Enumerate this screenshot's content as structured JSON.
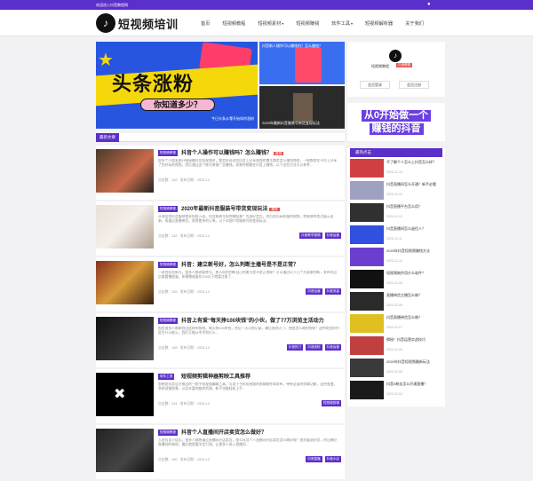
{
  "topbar": {
    "welcome": "欢迎进入抖音教程网"
  },
  "logo": {
    "text": "短视频培训"
  },
  "nav": [
    "首页",
    "短视频教程",
    "短视频素材",
    "短视频赚钱",
    "软件工具",
    "短视频解析器",
    "关于我们"
  ],
  "hero": {
    "main_title": "头条涨粉",
    "main_pill": "你知道多少？",
    "main_caption": "今日头条从零开始如何涨粉",
    "r1_caption": "抖音新人操作可以赚钱吗？怎么赚钱？",
    "r2_caption": "2020年最新抖音服装号带货变现玩法"
  },
  "section": {
    "title": "最新文章"
  },
  "articles": [
    {
      "badge": "短视频教程",
      "title": "抖音个人操作可以赚钱吗？怎么赚钱？",
      "hot": "推荐",
      "desc": "很多个人朋友刚开始接触抖音短视频时，都会好奇这些抖音上分享视频的博主都是怎么赚到钱的，一般都是在平台上分享了些好玩的视频，然后通过这个账号来接广告赚钱。如果你想要在抖音上赚钱，以下这些方法可以参考...",
      "views": "152",
      "date": "2020-12",
      "tags": []
    },
    {
      "badge": "短视频教程",
      "title": "2020年最新抖音服装号带货变现玩法",
      "hot": "推荐",
      "desc": "从淘宝到抖音服装商家纷纷入局，抖音服装号如何做起来？先选好定位，然后拍出高质量的视频，把服装的卖点展示出来。再通过直播带货，获得更多的订单。以下详细介绍服装号的变现玩法...",
      "views": "132",
      "date": "2020-12",
      "tags": [
        "抖音教学视频",
        "抖音运营"
      ]
    },
    {
      "badge": "短视频教程",
      "title": "抖音：建立新号好，怎么判断主播号是不是正常？",
      "hot": "",
      "desc": "一说到抖音新号，很多人都说要养号，那么如何判断自己的账号是不是正常呢？可以通过以下几个方面来判断，发布作品后查看播放量，如果播放量在200以下就要注意了...",
      "views": "226",
      "date": "2020-12",
      "tags": [
        "抖音运营",
        "抖音流量"
      ]
    },
    {
      "badge": "短视频教程",
      "title": "抖音上有爱“每天挣100块钱”的小伙，做了77万浏览主活动力",
      "hot": "",
      "desc": "相信很多人都刷到过这样的视频，每天挣100块钱，然后一天天地记录，最后竟然火了。他是怎么做到的呢？这种类型的内容为什么能火，我们又能从中学到什么...",
      "views": "168",
      "date": "2020-12",
      "tags": [
        "抖音热门",
        "抖音涨粉",
        "抖音运营"
      ]
    },
    {
      "badge": "软件工具",
      "title": "短视频剪辑神器剪映工具推荐",
      "hot": "",
      "desc": "剪映是抖音官方推出的一款手机视频编辑工具，可用于手机短视频的剪辑制作和发布，带有全面的剪辑功能，支持变速，多样滤镜效果，以及丰富的曲库资源，新手也能轻松上手...",
      "views": "244",
      "date": "2020-12",
      "tags": [
        "短视频剪辑"
      ]
    },
    {
      "badge": "短视频教程",
      "title": "抖音个人直播间开店卖货怎么做好？",
      "hot": "",
      "desc": "入驻抖音小店后，很多人都想通过直播间开店卖货，那么抖音个人直播间开店卖货怎么做好呢？首先要选好货，然后做好直播间的装修，最后就是要学会引流，让更多人进入直播间...",
      "views": "190",
      "date": "2020-12",
      "tags": [
        "抖音直播",
        "抖音小店"
      ]
    }
  ],
  "profile": {
    "name": "短视频教程",
    "tag": "抖音教程",
    "btn1": "会员登录",
    "btn2": "会员注册"
  },
  "banner": {
    "line1": "从0开始做一个",
    "line2": "赚钱的抖音"
  },
  "hot": {
    "title": "最热点击",
    "items": [
      {
        "t": "不了解个人怎么上抖音怎么样？",
        "d": "2020-12-15"
      },
      {
        "t": "抖音直播间怎么开通？新手必看",
        "d": "2020-12-13"
      },
      {
        "t": "抖音直播平台怎么用？",
        "d": "2020-12-12"
      },
      {
        "t": "抖音直播间怎么留住人？",
        "d": "2020-12-11"
      },
      {
        "t": "2020年抖音短视频赚钱方法",
        "d": "2020-12-10"
      },
      {
        "t": "短视频制作用什么软件？",
        "d": "2020-12-09"
      },
      {
        "t": "直播带货主播怎么做？",
        "d": "2020-12-08"
      },
      {
        "t": "抖音直播带货怎么做？",
        "d": "2020-12-07"
      },
      {
        "t": "揭秘！抖音运营实战技巧",
        "d": "2020-12-06"
      },
      {
        "t": "2020年抖音短视频最新玩法",
        "d": "2020-12-05"
      },
      {
        "t": "抖音0粉丝怎么开通直播？",
        "d": "2020-12-04"
      }
    ]
  }
}
